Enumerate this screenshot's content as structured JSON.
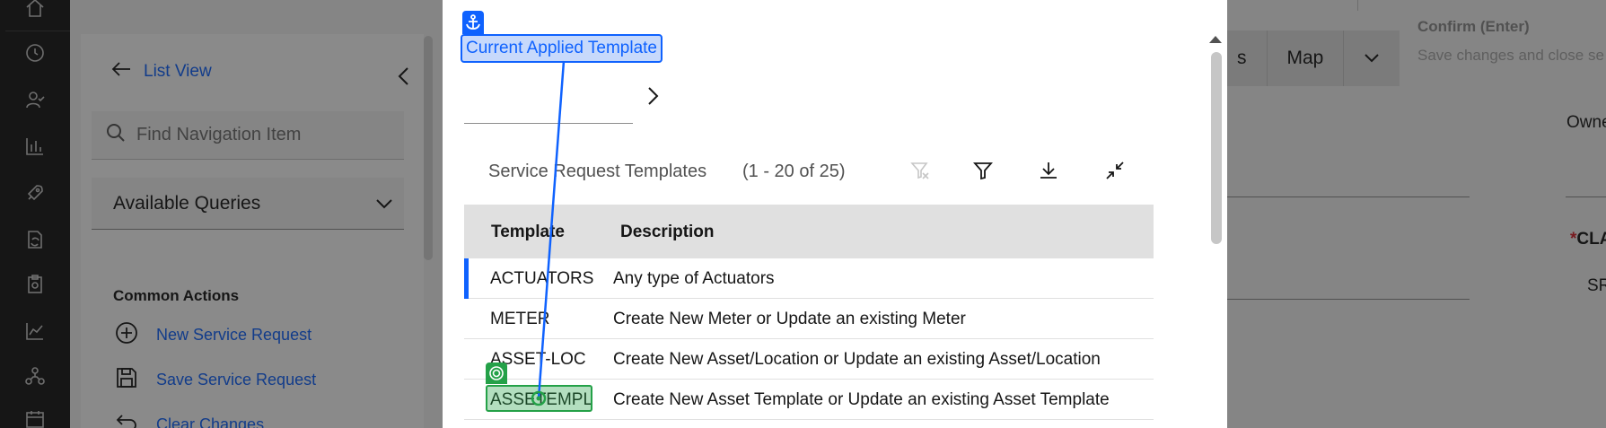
{
  "rail": {
    "icons": [
      "home-icon",
      "history-icon",
      "person-check-icon",
      "bar-chart-icon",
      "rocket-icon",
      "document-sync-icon",
      "clipboard-icon",
      "line-chart-icon",
      "network-icon",
      "calendar-icon"
    ]
  },
  "nav": {
    "back_label": "List View",
    "search_placeholder": "Find Navigation Item",
    "queries_label": "Available Queries",
    "common_actions_title": "Common Actions",
    "actions": [
      {
        "label": "New Service Request",
        "icon": "add-circle-icon"
      },
      {
        "label": "Save Service Request",
        "icon": "save-icon"
      },
      {
        "label": "Clear Changes",
        "icon": "undo-icon"
      }
    ]
  },
  "background": {
    "tabs": [
      "s",
      "Map"
    ],
    "owner_label": "Owne",
    "class_label": "CLA",
    "class_value": "SR",
    "confirm_title": "Confirm (Enter)",
    "confirm_sub": "Save changes and close se"
  },
  "modal": {
    "current_template_label": "Current Applied Template",
    "table_title": "Service Request Templates",
    "table_count": "(1 - 20 of 25)",
    "columns": [
      "Template",
      "Description"
    ],
    "rows": [
      {
        "template": "ACTUATORS",
        "description": "Any type of Actuators"
      },
      {
        "template": "METER",
        "description": "Create New Meter or Update an existing Meter"
      },
      {
        "template": "ASSET-LOC",
        "description": "Create New Asset/Location or Update an existing Asset/Location"
      },
      {
        "template": "ASSETEMPL",
        "description": "Create New Asset Template or Update an existing Asset Template"
      }
    ],
    "colors": {
      "anchor": "#0f62fe",
      "target": "#24a148"
    }
  }
}
